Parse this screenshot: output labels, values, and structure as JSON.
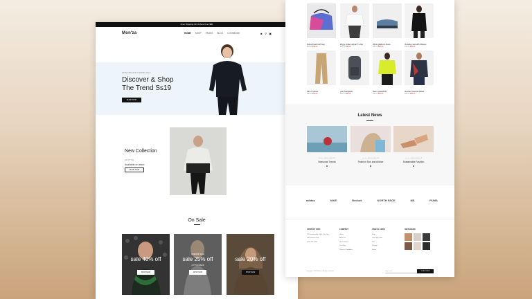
{
  "left_page": {
    "promo_bar": "Free Shipping On Orders Over $80",
    "logo": "Mon'za",
    "menu": [
      "HOME",
      "SHOP",
      "PAGES",
      "BLOG",
      "LOOKBOOK"
    ],
    "hero": {
      "tag": "EXTRA 35% OFF IN SPRING SALE",
      "title_line1": "Discover & Shop",
      "title_line2": "The Trend Ss19",
      "button": "SHOP NOW"
    },
    "new_collection": {
      "title": "New Collection",
      "sub": "ADI STYLE",
      "sub2": "Available on store",
      "button": "SHOP NOW"
    },
    "on_sale": {
      "title": "On Sale",
      "cards": [
        {
          "label": "sale 40% off",
          "button": "SHOP NOW"
        },
        {
          "top": "WEEKEND SALE",
          "label": "sale 25% off",
          "sub": "COTTON WEAR",
          "button": "SHOP NOW"
        },
        {
          "label": "sale 20% off",
          "button": "SHOP NOW"
        }
      ]
    }
  },
  "right_page": {
    "products": [
      {
        "name": "Dolce Flash belt bag",
        "price_old": "$40.00",
        "price": "$30.00"
      },
      {
        "name": "Piggy strider airpart T-shirt",
        "price_old": "$40.00",
        "price": "$30.00"
      },
      {
        "name": "White platform boots",
        "price_old": "$40.00",
        "price": "$30.00"
      },
      {
        "name": "Outside coat with ribbons",
        "price_old": "$40.00",
        "price": "$30.00"
      },
      {
        "name": "Slim fit pants",
        "price_old": "$40.00",
        "price": "$30.00"
      },
      {
        "name": "gray backpack",
        "price_old": "$40.00",
        "price": "$30.00"
      },
      {
        "name": "Neon sweatshirt",
        "price_old": "$40.00",
        "price": "$30.00"
      },
      {
        "name": "Hooded nautical jacket",
        "price_old": "$40.00",
        "price": "$30.00"
      }
    ],
    "news": {
      "title": "Latest News",
      "items": [
        {
          "meta": "Jan 18 · FASHION ADVICE",
          "title": "Seasonal Trends"
        },
        {
          "meta": "Jan 18 · FASHION ADVICE",
          "title": "Fashion Tips and Advice"
        },
        {
          "meta": "Jan 18 · FASHION ADVICE",
          "title": "Sustainable Fashion"
        }
      ]
    },
    "brands": [
      "adidas",
      "NIKE",
      "Reebok",
      "NORTH FACE",
      "NB",
      "PUMA"
    ],
    "footer": {
      "contact_title": "CONTACT INFO",
      "contact": [
        "123 Fashion Ave, Style City, CA",
        "info@monza.com",
        "(123) 456-7890"
      ],
      "company_title": "COMPANY",
      "company": [
        "Home",
        "About Us",
        "Work With Us",
        "Our Blog",
        "Terms & Conditions"
      ],
      "links_title": "USEFUL LINKS",
      "links": [
        "Help",
        "Track My Order",
        "Men",
        "Women",
        "Shoes"
      ],
      "insta_title": "INSTAGRAM",
      "copyright": "Copyright © 2023 Mon'za. All rights reserved.",
      "subscribe_placeholder": "Enter email",
      "subscribe_button": "SUBSCRIBE"
    }
  }
}
